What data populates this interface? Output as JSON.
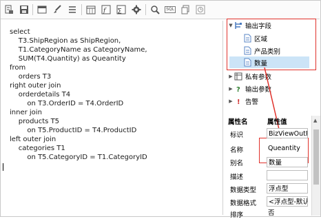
{
  "toolbar": {
    "icons": [
      "cut-icon",
      "save-icon",
      "window-icon",
      "brush-icon",
      "list-icon",
      "calendar-icon",
      "function-icon",
      "formula-icon",
      "gear-icon",
      "search-icon",
      "sql-icon",
      "pages-icon",
      "clock-icon"
    ],
    "sql_label": "SQL"
  },
  "editor": {
    "lines": [
      "select",
      "    T3.ShipRegion as ShipRegion,",
      "    T1.CategoryName as CategoryName,",
      "    SUM(T4.Quantity) as Queantity",
      "from",
      "    orders T3",
      "right outer join",
      "    orderdetails T4",
      "        on T3.OrderID = T4.OrderID",
      "inner join",
      "    products T5",
      "        on T5.ProductID = T4.ProductID",
      "left outer join",
      "    categories T1",
      "        on T5.CategoryID = T1.CategoryID"
    ]
  },
  "tree": {
    "output_fields": "输出字段",
    "fields": [
      "区域",
      "产品类别",
      "数量"
    ],
    "private_params": "私有参数",
    "output_params": "输出参数",
    "warning": "告警"
  },
  "properties": {
    "header_name": "属性名",
    "header_value": "属性值",
    "rows": [
      {
        "label": "标识",
        "value": "BizViewOutF"
      },
      {
        "label": "名称",
        "value": "Queantity"
      },
      {
        "label": "别名",
        "value": "数量"
      },
      {
        "label": "描述",
        "value": ""
      },
      {
        "label": "数据类型",
        "value": "浮点型"
      },
      {
        "label": "数据格式",
        "value": "<浮点型-默认值"
      },
      {
        "label": "排序",
        "value": "否"
      }
    ]
  },
  "colors": {
    "highlight": "#e0302a",
    "selection": "#cce4f7"
  }
}
